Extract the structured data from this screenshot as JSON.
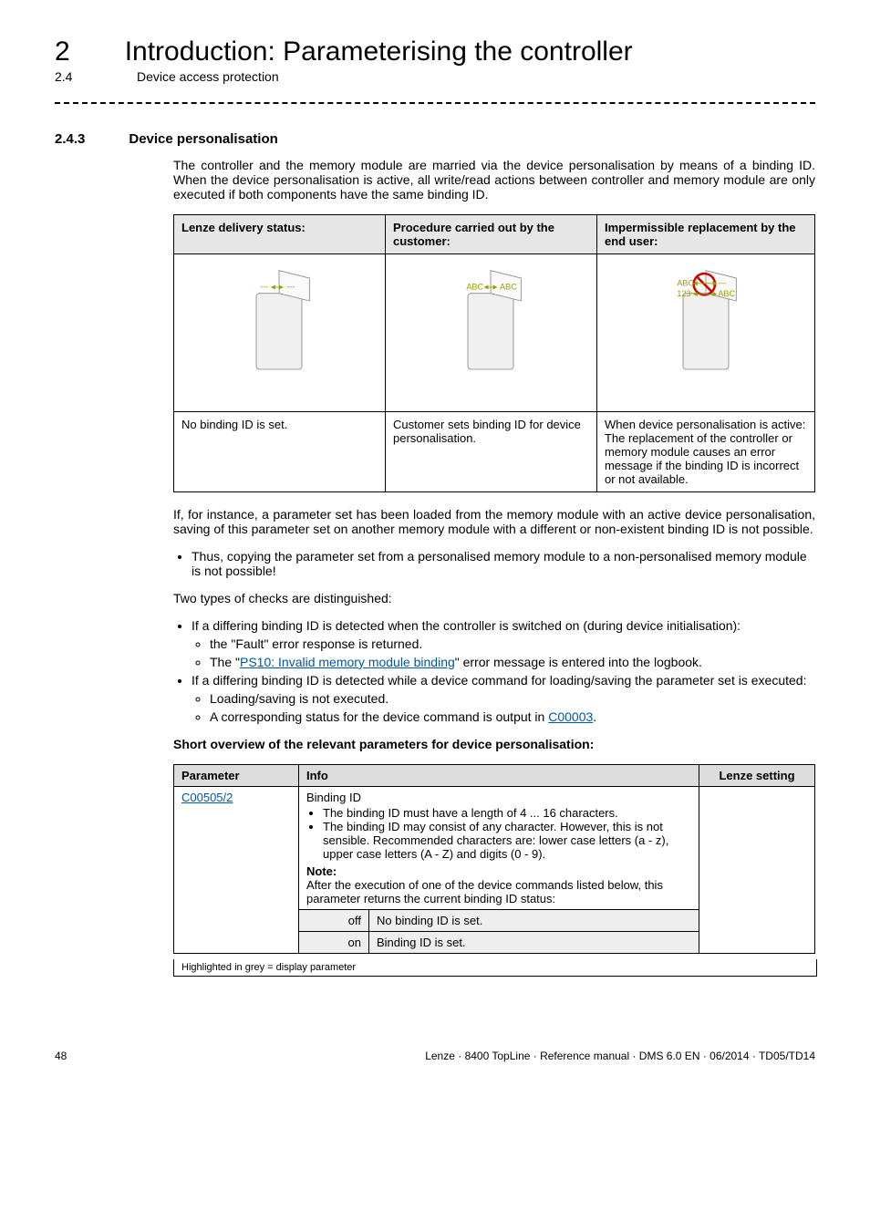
{
  "chapter": {
    "num": "2",
    "title": "Introduction: Parameterising the controller"
  },
  "header": {
    "section": "2.4",
    "title": "Device access protection"
  },
  "section": {
    "num": "2.4.3",
    "title": "Device personalisation"
  },
  "intro": "The controller and the memory module are married via the device personalisation by means of a binding ID. When the device personalisation is active, all write/read actions between controller and memory module are only executed if both components have the same binding ID.",
  "boxTable": {
    "headers": [
      "Lenze delivery status:",
      "Procedure carried out by the customer:",
      "Impermissible replacement by the end user:"
    ],
    "notes": [
      "No binding ID is set.",
      "Customer sets binding ID for device personalisation.",
      "When device personalisation is active:\nThe replacement of the controller or memory module causes an error message if the binding ID is incorrect or not available."
    ],
    "svgLabels": {
      "dash": "---",
      "abc": "ABC",
      "num": "123"
    }
  },
  "afterBox": {
    "p1": "If, for instance, a parameter set has been loaded from the memory module with an active device personalisation, saving of this parameter set on another memory module with a different or non-existent binding ID is not possible.",
    "bullet1": "Thus, copying the parameter set from a personalised memory module to a non-personalised memory module is not possible!",
    "p2": "Two types of checks are distinguished:",
    "b2": "If a differing binding ID is detected when the controller is switched on (during device initialisation):",
    "b2a": "the \"Fault\" error response is returned.",
    "b2b_pre": "The \"",
    "b2b_link": "PS10: Invalid memory module binding",
    "b2b_post": "\" error message is entered into the logbook.",
    "b3": "If a differing binding ID is detected while a device command for loading/saving the parameter set is executed:",
    "b3a": "Loading/saving is not executed.",
    "b3b_pre": "A corresponding status for the device command is output in ",
    "b3b_link": "C00003",
    "b3b_post": "."
  },
  "paramHeading": "Short overview of the relevant parameters for device personalisation:",
  "paramTable": {
    "headers": [
      "Parameter",
      "Info",
      "Lenze setting"
    ],
    "rows": {
      "paramLink": "C00505/2",
      "infoTitle": "Binding ID",
      "info1": "The binding ID must have a length of 4 ... 16 characters.",
      "info2": "The binding ID may consist of any character. However, this is not sensible. Recommended characters are: lower case letters (a - z), upper case letters (A - Z) and digits (0 - 9).",
      "noteLabel": "Note:",
      "noteText": "After the execution of one of the device commands listed below, this parameter returns the current binding ID status:",
      "off": "off",
      "offDesc": "No binding ID is set.",
      "on": "on",
      "onDesc": "Binding ID is set."
    },
    "footnote": "Highlighted in grey = display parameter"
  },
  "footer": {
    "page": "48",
    "right": "Lenze · 8400 TopLine · Reference manual · DMS 6.0 EN · 06/2014 · TD05/TD14"
  }
}
